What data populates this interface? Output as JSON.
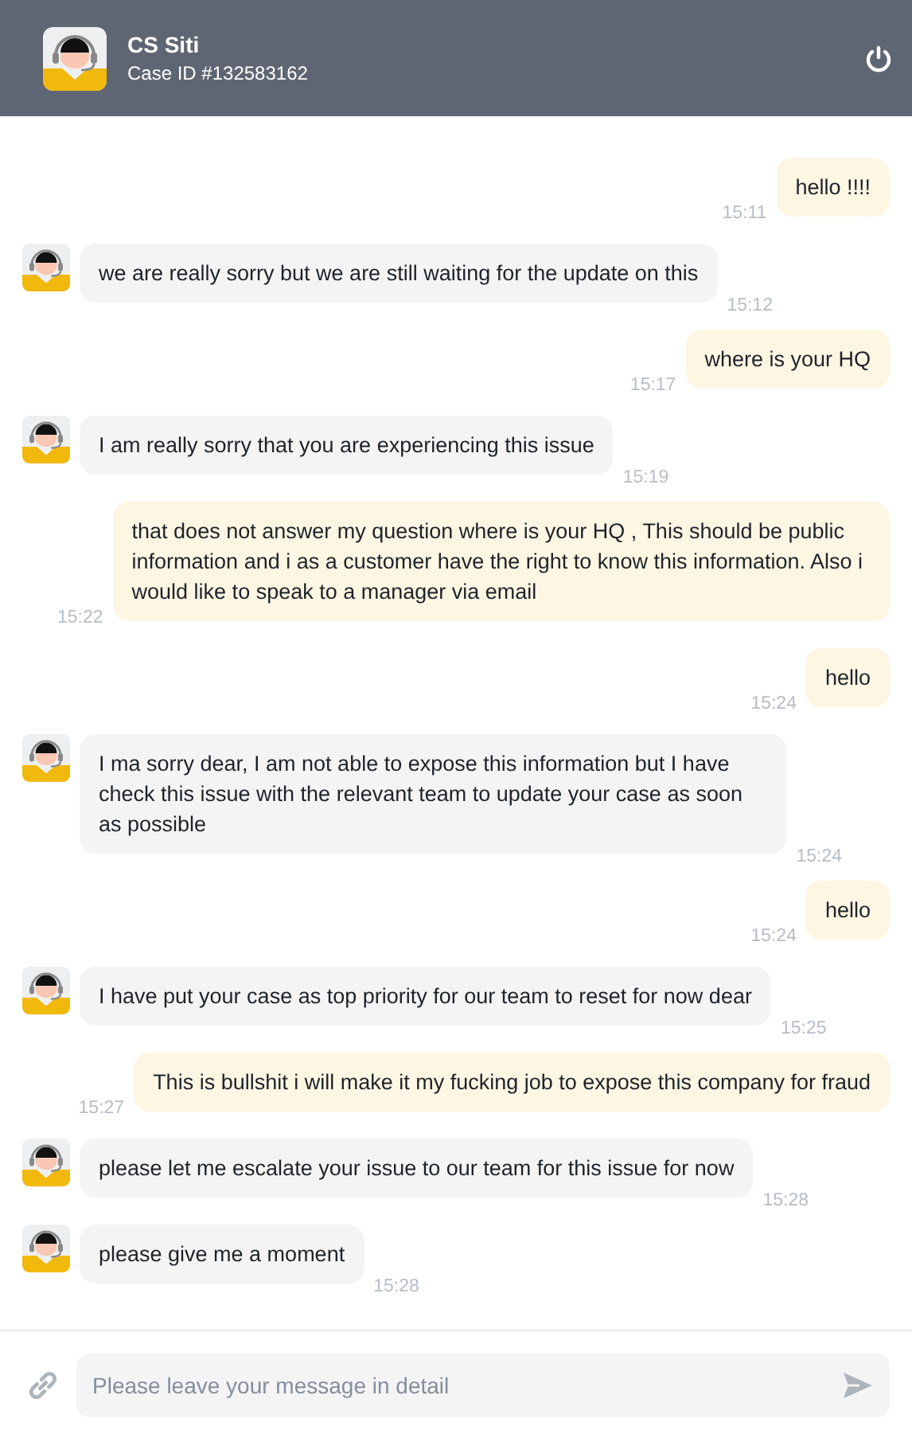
{
  "header": {
    "name": "CS Siti",
    "case_id": "Case ID #132583162"
  },
  "messages": [
    {
      "kind": "customer",
      "text": "hello !!!!",
      "time": "15:11"
    },
    {
      "kind": "agent",
      "text": "we are really sorry but we are still waiting for the update on this",
      "time": "15:12"
    },
    {
      "kind": "customer",
      "text": "where is your HQ",
      "time": "15:17"
    },
    {
      "kind": "agent",
      "text": "I am really sorry that you are experiencing this issue",
      "time": "15:19"
    },
    {
      "kind": "customer",
      "text": "that does not answer my question where is your HQ , This should be public information and i as a customer have the right to know this information. Also i would like to speak to a manager via email",
      "time": "15:22"
    },
    {
      "kind": "customer",
      "text": "hello",
      "time": "15:24"
    },
    {
      "kind": "agent",
      "text": "I ma sorry dear, I am not able to expose this information but I have check this issue with the relevant team to update your case as soon as possible",
      "time": "15:24"
    },
    {
      "kind": "customer",
      "text": "hello",
      "time": "15:24"
    },
    {
      "kind": "agent",
      "text": "I have put your case as top priority for our team to reset for now dear",
      "time": "15:25"
    },
    {
      "kind": "customer",
      "text": "This is bullshit i will make it my fucking job to expose this company for fraud",
      "time": "15:27"
    },
    {
      "kind": "agent",
      "text": "please let me escalate your issue to our team for this issue for now",
      "time": "15:28"
    },
    {
      "kind": "agent",
      "text": "please give me a moment",
      "time": "15:28"
    }
  ],
  "input": {
    "placeholder": "Please leave your message in detail"
  }
}
